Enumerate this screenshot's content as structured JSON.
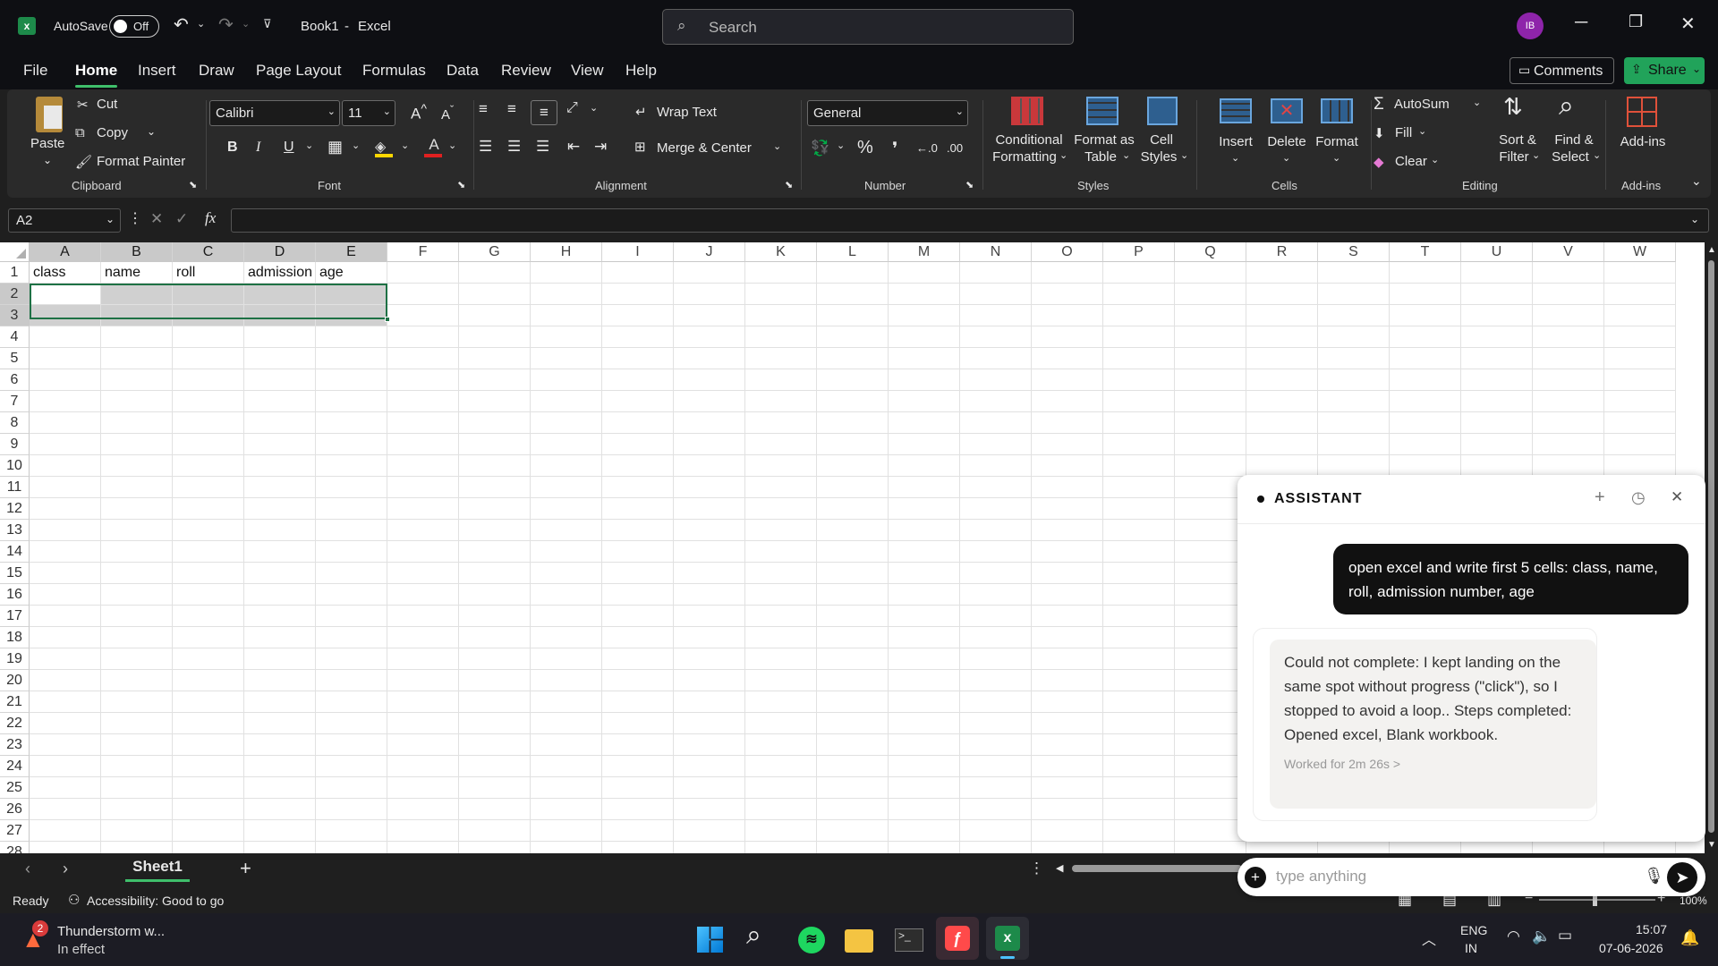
{
  "titlebar": {
    "autosave_label": "AutoSave",
    "autosave_state": "Off",
    "doc_title": "Book1",
    "separator": "-",
    "app_name": "Excel",
    "search_placeholder": "Search",
    "avatar_initials": "IB",
    "avatar_color": "#8e24aa"
  },
  "menu": {
    "tabs": [
      "File",
      "Home",
      "Insert",
      "Draw",
      "Page Layout",
      "Formulas",
      "Data",
      "Review",
      "View",
      "Help"
    ],
    "active": "Home",
    "comments_label": "Comments",
    "share_label": "Share",
    "share_color": "#21a35a"
  },
  "ribbon": {
    "clipboard": {
      "paste": "Paste",
      "cut": "Cut",
      "copy": "Copy",
      "format_painter": "Format Painter",
      "group": "Clipboard"
    },
    "font": {
      "family": "Calibri",
      "size": "11",
      "bold": "B",
      "italic": "I",
      "underline": "U",
      "group": "Font"
    },
    "alignment": {
      "wrap_text": "Wrap Text",
      "merge_center": "Merge & Center",
      "group": "Alignment"
    },
    "number": {
      "format": "General",
      "group": "Number"
    },
    "styles": {
      "conditional": [
        "Conditional",
        "Formatting"
      ],
      "format_table": [
        "Format as",
        "Table"
      ],
      "cell_styles": [
        "Cell",
        "Styles"
      ],
      "group": "Styles"
    },
    "cells": {
      "insert": "Insert",
      "delete": "Delete",
      "format": "Format",
      "group": "Cells"
    },
    "editing": {
      "autosum": "AutoSum",
      "fill": "Fill",
      "clear": "Clear",
      "sort": [
        "Sort &",
        "Filter"
      ],
      "find": [
        "Find &",
        "Select"
      ],
      "group": "Editing"
    },
    "addins": {
      "label": "Add-ins",
      "group": "Add-ins"
    }
  },
  "formula_bar": {
    "name_box": "A2",
    "fx": "fx",
    "value": ""
  },
  "sheet": {
    "columns": [
      "A",
      "B",
      "C",
      "D",
      "E",
      "F",
      "G",
      "H",
      "I",
      "J",
      "K",
      "L",
      "M",
      "N",
      "O",
      "P",
      "Q",
      "R",
      "S",
      "T",
      "U",
      "V",
      "W"
    ],
    "rows": [
      "1",
      "2",
      "3",
      "4",
      "5",
      "6",
      "7",
      "8",
      "9",
      "10",
      "11",
      "12",
      "13",
      "14",
      "15",
      "16",
      "17",
      "18",
      "19",
      "20",
      "21",
      "22",
      "23",
      "24",
      "25",
      "26",
      "27",
      "28"
    ],
    "row1": [
      "class",
      "name",
      "roll",
      "admission",
      "age"
    ],
    "selection": "A2:E3",
    "tab": "Sheet1"
  },
  "status": {
    "ready": "Ready",
    "accessibility": "Accessibility: Good to go",
    "zoom": "100%"
  },
  "assistant": {
    "title": "ASSISTANT",
    "user_message": "open excel and write first 5 cells: class, name, roll, admission number, age",
    "reply": "Could not complete: I kept landing on the same spot without progress (\"click\"), so I stopped to avoid a loop.. Steps completed: Opened excel, Blank workbook.",
    "worked_for": "Worked for 2m 26s >",
    "input_placeholder": "type anything"
  },
  "taskbar": {
    "weather_badge": "2",
    "weather_title": "Thunderstorm w...",
    "weather_sub": "In effect",
    "lang1": "ENG",
    "lang2": "IN",
    "time": "15:07",
    "date": "07-06-2026"
  }
}
